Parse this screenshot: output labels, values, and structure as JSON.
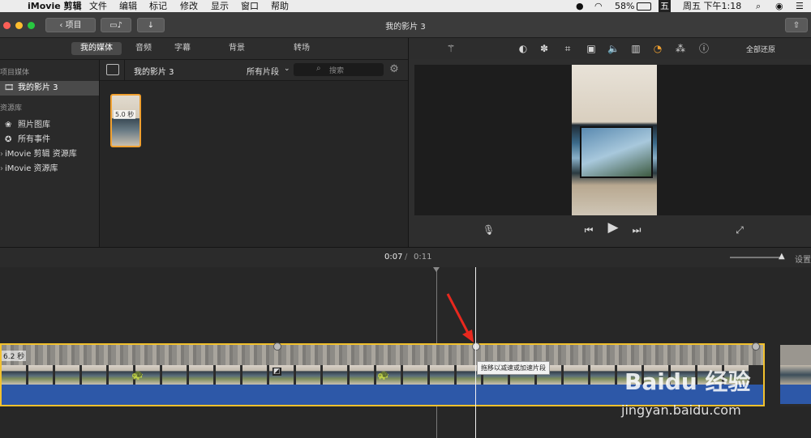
{
  "menubar": {
    "app_name": "iMovie 剪辑",
    "items": [
      "文件",
      "编辑",
      "标记",
      "修改",
      "显示",
      "窗口",
      "帮助"
    ],
    "battery": "58%",
    "input_method": "五",
    "clock": "周五 下午1:18"
  },
  "titlebar": {
    "back_label": "项目",
    "title": "我的影片 3"
  },
  "tabs": [
    "我的媒体",
    "音频",
    "字幕",
    "背景",
    "转场"
  ],
  "sidebar": {
    "section_project": "项目媒体",
    "project_item": "我的影片 3",
    "section_library": "资源库",
    "photos": "照片图库",
    "all_events": "所有事件",
    "library1": "iMovie 剪辑 资源库",
    "library2": "iMovie 资源库"
  },
  "browser": {
    "title": "我的影片 3",
    "filter": "所有片段",
    "search_placeholder": "搜索",
    "clip_duration": "5.0 秒"
  },
  "viewer": {
    "reset_all": "全部还原"
  },
  "timebar": {
    "current_time": "0:07",
    "separator": "/",
    "total_time": "0:11",
    "settings": "设置"
  },
  "timeline": {
    "clip_duration": "6.2 秒",
    "tooltip": "拖移以减速或加速片段"
  },
  "watermark": {
    "brand": "Baidu 经验",
    "url": "jingyan.baidu.com"
  },
  "colors": {
    "accent_orange": "#f0a030",
    "selection_yellow": "#f2c12e",
    "audio_blue": "#2d58a8",
    "arrow_red": "#e8281e"
  }
}
